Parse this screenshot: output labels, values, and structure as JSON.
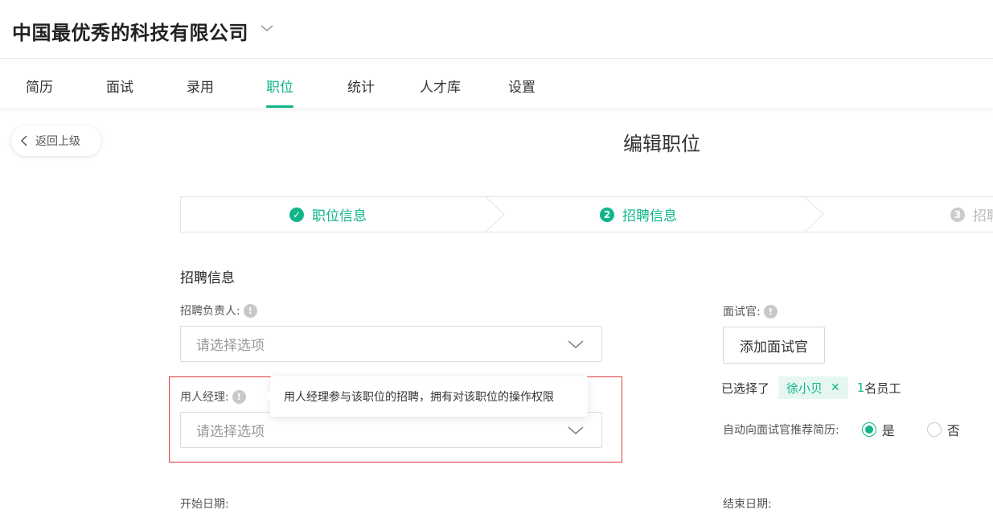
{
  "header": {
    "company_name": "中国最优秀的科技有限公司"
  },
  "nav": {
    "items": [
      {
        "label": "简历"
      },
      {
        "label": "面试"
      },
      {
        "label": "录用"
      },
      {
        "label": "职位",
        "active": true
      },
      {
        "label": "统计"
      },
      {
        "label": "人才库"
      },
      {
        "label": "设置"
      }
    ]
  },
  "back_label": "返回上级",
  "page_title": "编辑职位",
  "steps": [
    {
      "label": "职位信息",
      "status": "done",
      "badge": "✓"
    },
    {
      "label": "招聘信息",
      "status": "current",
      "badge": "2"
    },
    {
      "label": "招聘",
      "status": "pending",
      "badge": "3"
    }
  ],
  "section_title": "招聘信息",
  "form": {
    "recruiter_label": "招聘负责人:",
    "recruiter_placeholder": "请选择选项",
    "hiring_manager_label": "用人经理:",
    "hiring_manager_placeholder": "请选择选项",
    "hiring_manager_tooltip": "用人经理参与该职位的招聘，拥有对该职位的操作权限",
    "start_date_label": "开始日期:",
    "interviewer_label": "面试官:",
    "add_interviewer_button": "添加面试官",
    "selected_prefix": "已选择了",
    "selected_tag": "徐小贝",
    "selected_count": "1",
    "selected_suffix": "名员工",
    "auto_recommend_label": "自动向面试官推荐简历:",
    "option_yes": "是",
    "option_no": "否",
    "end_date_label": "结束日期:"
  },
  "colors": {
    "accent": "#0fb58a",
    "highlight_border": "#e43a3a"
  },
  "icons": {
    "company_dropdown": "chevron-down-icon",
    "back": "chevron-left-icon",
    "info": "info-icon",
    "select_arrow": "chevron-down-icon",
    "tag_remove": "close-icon"
  }
}
